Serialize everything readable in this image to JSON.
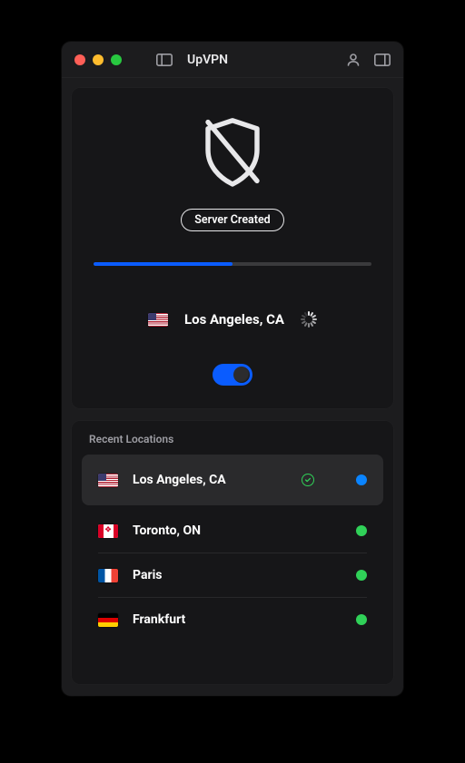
{
  "app": {
    "title": "UpVPN"
  },
  "status": {
    "label": "Server Created",
    "progress_percent": 50,
    "connection_on": true
  },
  "current_location": {
    "label": "Los Angeles, CA",
    "flag": "us"
  },
  "recent": {
    "title": "Recent Locations",
    "items": [
      {
        "label": "Los Angeles, CA",
        "flag": "us",
        "selected": true,
        "indicator": "blue",
        "verified": true
      },
      {
        "label": "Toronto, ON",
        "flag": "ca",
        "selected": false,
        "indicator": "green",
        "verified": false
      },
      {
        "label": "Paris",
        "flag": "fr",
        "selected": false,
        "indicator": "green",
        "verified": false
      },
      {
        "label": "Frankfurt",
        "flag": "de",
        "selected": false,
        "indicator": "green",
        "verified": false
      }
    ]
  },
  "colors": {
    "accent": "#0a5cff",
    "bg_window": "#1c1c1e",
    "bg_card": "#161618",
    "status_green": "#30d158",
    "status_blue": "#0a84ff"
  }
}
